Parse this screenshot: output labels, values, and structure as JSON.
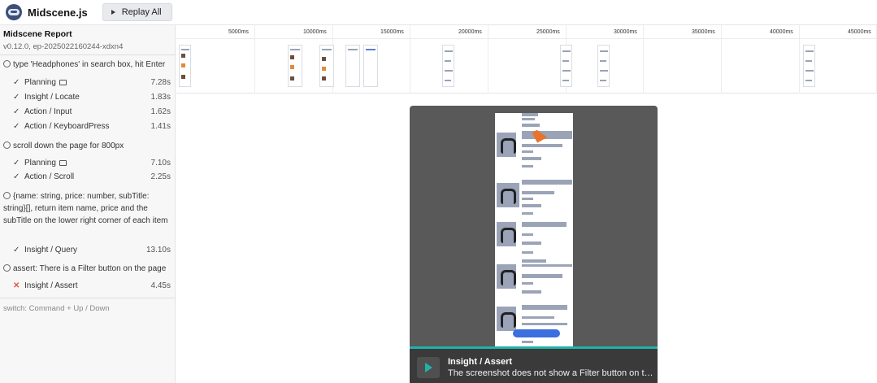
{
  "header": {
    "title": "Midscene.js",
    "replay_label": "Replay All"
  },
  "sidebar": {
    "report_title": "Midscene Report",
    "version": "v0.12.0, ep-20250221602​44-xdxn4",
    "tasks": [
      {
        "name": "type 'Headphones' in search box, hit Enter",
        "steps": [
          {
            "label": "Planning",
            "duration": "7.28s",
            "status": "success",
            "camera": true
          },
          {
            "label": "Insight / Locate",
            "duration": "1.83s",
            "status": "success"
          },
          {
            "label": "Action / Input",
            "duration": "1.62s",
            "status": "success"
          },
          {
            "label": "Action / KeyboardPress",
            "duration": "1.41s",
            "status": "success"
          }
        ]
      },
      {
        "name": "scroll down the page for 800px",
        "steps": [
          {
            "label": "Planning",
            "duration": "7.10s",
            "status": "success",
            "camera": true
          },
          {
            "label": "Action / Scroll",
            "duration": "2.25s",
            "status": "success"
          }
        ]
      },
      {
        "name": "{name: string, price: number, subTitle: string}[], return item name, price and the subTitle on the lower right corner of each item",
        "steps": [
          {
            "label": "Insight / Query",
            "duration": "13.10s",
            "status": "success"
          }
        ]
      },
      {
        "name": "assert: There is a Filter button on the page",
        "steps": [
          {
            "label": "Insight / Assert",
            "duration": "4.45s",
            "status": "failed"
          }
        ]
      }
    ],
    "switch_hint": "switch: Command + Up / Down"
  },
  "timeline": {
    "ticks": [
      "5000ms",
      "10000ms",
      "15000ms",
      "20000ms",
      "25000ms",
      "30000ms",
      "35000ms",
      "40000ms",
      "45000ms"
    ]
  },
  "player": {
    "caption_title": "Insight / Assert",
    "caption_desc": "The screenshot does not show a Filter button on the page"
  },
  "colors": {
    "accent": "#20b2aa",
    "failed": "#e05a3b",
    "cursor": "#e8742c"
  }
}
